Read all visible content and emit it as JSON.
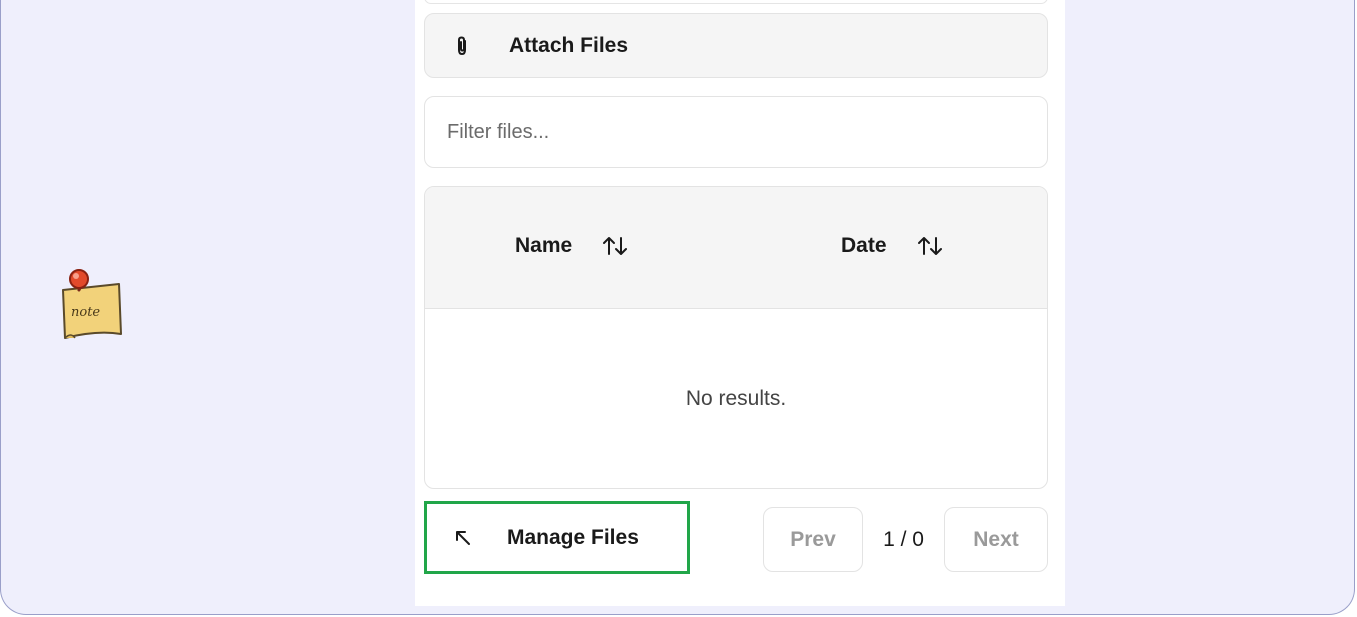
{
  "attach": {
    "icon": "paperclip-icon",
    "label": "Attach Files"
  },
  "filter": {
    "placeholder": "Filter files...",
    "value": ""
  },
  "table": {
    "columns": [
      {
        "label": "Name",
        "icon": "sort-arrows-icon"
      },
      {
        "label": "Date",
        "icon": "sort-arrows-icon"
      }
    ],
    "rows": [],
    "empty_message": "No results."
  },
  "footer": {
    "manage_icon": "arrow-up-left-icon",
    "manage_label": "Manage Files",
    "prev_label": "Prev",
    "page_indicator": "1 / 0",
    "next_label": "Next"
  },
  "sticker": {
    "text": "note",
    "icon": "note-sticker-icon"
  },
  "colors": {
    "background": "#efeffc",
    "panel": "#ffffff",
    "highlight": "#21a649",
    "pin": "#e24a2b",
    "note_paper": "#f2d27a"
  }
}
